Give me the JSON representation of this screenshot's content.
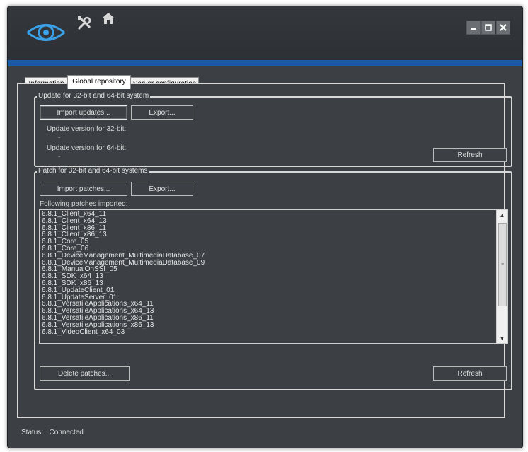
{
  "window": {
    "controls": [
      "minimize-icon",
      "maximize-icon",
      "close-icon"
    ],
    "icons": [
      "eye-logo-icon",
      "tools-icon",
      "home-icon"
    ],
    "accent_color": "#1a5aa8"
  },
  "tabs": [
    {
      "label": "Information",
      "active": false
    },
    {
      "label": "Global repository",
      "active": true
    },
    {
      "label": "Server configuration",
      "active": false
    }
  ],
  "updates_group": {
    "title": "Update for 32-bit and 64-bit system",
    "import_label": "Import updates...",
    "export_label": "Export...",
    "version32_label": "Update version for 32-bit:",
    "version32_value": "-",
    "version64_label": "Update version for 64-bit:",
    "version64_value": "-",
    "refresh_label": "Refresh"
  },
  "patches_group": {
    "title": "Patch for 32-bit and 64-bit systems",
    "import_label": "Import patches...",
    "export_label": "Export...",
    "list_label": "Following patches imported:",
    "patches": [
      "6.8.1_Client_x64_11",
      "6.8.1_Client_x64_13",
      "6.8.1_Client_x86_11",
      "6.8.1_Client_x86_13",
      "6.8.1_Core_05",
      "6.8.1_Core_06",
      "6.8.1_DeviceManagement_MultimediaDatabase_07",
      "6.8.1_DeviceManagement_MultimediaDatabase_09",
      "6.8.1_ManualOnSSI_05",
      "6.8.1_SDK_x64_13",
      "6.8.1_SDK_x86_13",
      "6.8.1_UpdateClient_01",
      "6.8.1_UpdateServer_01",
      "6.8.1_VersatileApplications_x64_11",
      "6.8.1_VersatileApplications_x64_13",
      "6.8.1_VersatileApplications_x86_11",
      "6.8.1_VersatileApplications_x86_13",
      "6.8.1_VideoClient_x64_03"
    ],
    "delete_label": "Delete patches...",
    "refresh_label": "Refresh"
  },
  "status": {
    "label": "Status:",
    "value": "Connected"
  }
}
